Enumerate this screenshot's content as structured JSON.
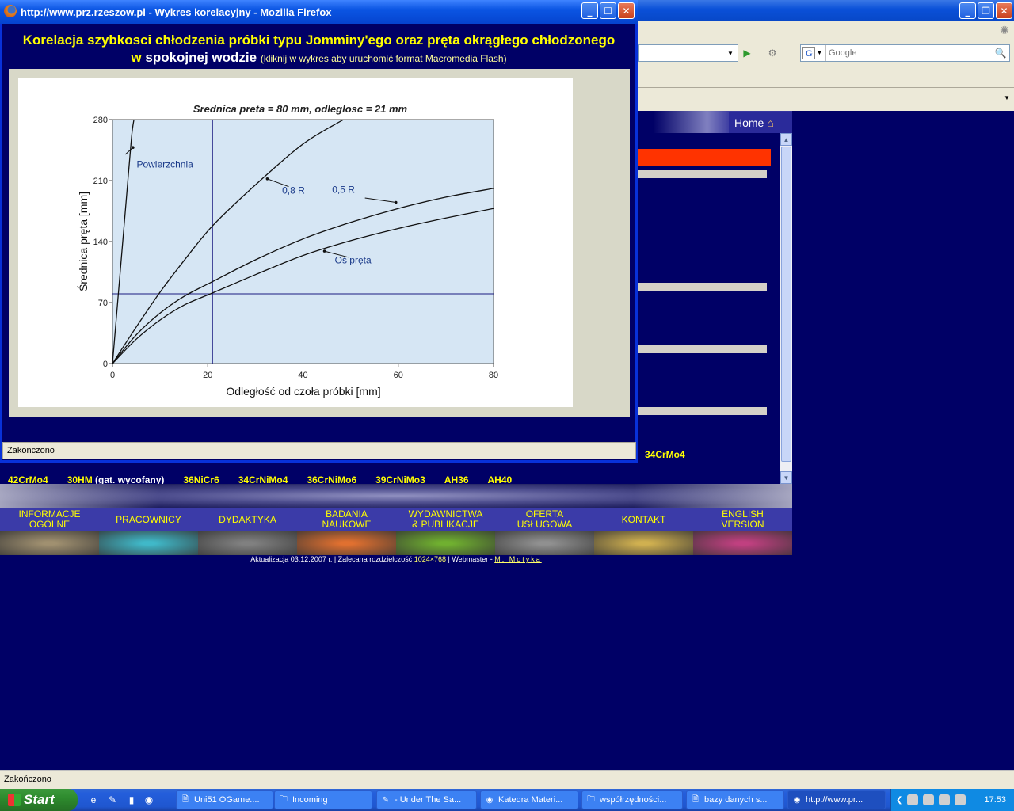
{
  "bg_window": {
    "search_placeholder": "Google",
    "home_label": "Home",
    "status": "Zakończono"
  },
  "site": {
    "steel_link_right": "34CrMo4",
    "steel_links": [
      {
        "label": "42CrMo4",
        "extra": ""
      },
      {
        "label": "30HM",
        "extra": " (gat. wycofany)"
      },
      {
        "label": "36NiCr6",
        "extra": ""
      },
      {
        "label": "34CrNiMo4",
        "extra": ""
      },
      {
        "label": "36CrNiMo6",
        "extra": ""
      },
      {
        "label": "39CrNiMo3",
        "extra": ""
      },
      {
        "label": "AH36",
        "extra": ""
      },
      {
        "label": "AH40",
        "extra": ""
      }
    ],
    "nav": [
      "INFORMACJE\nOGÓLNE",
      "PRACOWNICY",
      "DYDAKTYKA",
      "BADANIA\nNAUKOWE",
      "WYDAWNICTWA\n& PUBLIKACJE",
      "OFERTA\nUSŁUGOWA",
      "KONTAKT",
      "ENGLISH\nVERSION"
    ],
    "nav_image_colors": [
      "#a09070",
      "#40b8c8",
      "#808080",
      "#e07030",
      "#70b030",
      "#909090",
      "#d0b050",
      "#c04080"
    ],
    "footer": {
      "prefix": "Aktualizacja 03.12.2007 r. | Zalecana rozdzielczość ",
      "resolution": "1024×768",
      "mid": " | Webmaster - ",
      "webmaster": "M. Motyka"
    }
  },
  "popup": {
    "title": "http://www.prz.rzeszow.pl - Wykres korelacyjny - Mozilla Firefox",
    "heading_line1": "Korelacja szybkosci chłodzenia próbki typu Jomminy'ego oraz pręta okrągłego chłodzonego",
    "heading_w": "w",
    "heading_water": "spokojnej wodzie",
    "heading_hint": "(kliknij w wykres aby uruchomić format Macromedia Flash)",
    "status": "Zakończono"
  },
  "chart_data": {
    "type": "line",
    "title": "Srednica preta = 80  mm,        odleglosc = 21 mm",
    "xlabel": "Odległość od czoła próbki  [mm]",
    "ylabel": "Średnica pręta  [mm]",
    "xlim": [
      0,
      80
    ],
    "ylim": [
      0,
      280
    ],
    "xticks": [
      0,
      20,
      40,
      60,
      80
    ],
    "yticks": [
      0,
      70,
      140,
      210,
      280
    ],
    "reference_x": 21,
    "reference_y": 80,
    "series": [
      {
        "name": "Powierzchnia",
        "x": [
          0,
          1,
          2,
          3,
          4,
          4.5
        ],
        "y": [
          0,
          65,
          130,
          195,
          260,
          280
        ]
      },
      {
        "name": "0,8 R",
        "x": [
          0,
          5,
          10,
          15,
          21,
          30,
          40,
          48.5
        ],
        "y": [
          0,
          42,
          82,
          118,
          158,
          205,
          252,
          280
        ]
      },
      {
        "name": "0,5 R",
        "x": [
          0,
          5,
          10,
          15,
          21,
          30,
          40,
          50,
          60,
          70,
          80
        ],
        "y": [
          0,
          33,
          58,
          77,
          94,
          119,
          143,
          162,
          178,
          191,
          201
        ]
      },
      {
        "name": "Oś pręta",
        "x": [
          0,
          5,
          10,
          15,
          21,
          30,
          40,
          50,
          60,
          70,
          80
        ],
        "y": [
          0,
          28,
          50,
          67,
          81,
          102,
          124,
          141,
          155,
          167,
          178
        ]
      }
    ],
    "grid": false,
    "plot_background": "#d6e6f4"
  },
  "taskbar": {
    "start": "Start",
    "tasks": [
      "Uni51 OGame....",
      "Incoming",
      "- Under The Sa...",
      "Katedra Materi...",
      "współrzędności...",
      "bazy danych s...",
      "http://www.pr..."
    ],
    "clock": "17:53"
  }
}
